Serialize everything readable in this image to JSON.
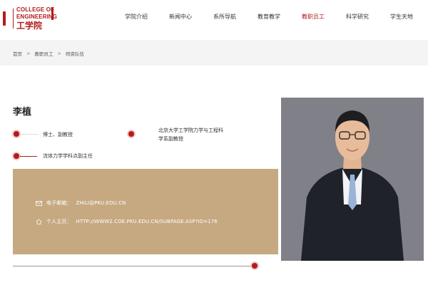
{
  "header": {
    "logo": {
      "en_line1": "COLLEGE OF",
      "en_line2": "ENGINEERING",
      "cn": "工学院"
    },
    "nav": [
      {
        "label": "学院介绍"
      },
      {
        "label": "新闻中心"
      },
      {
        "label": "系所导航"
      },
      {
        "label": "教育教学"
      },
      {
        "label": "教职员工",
        "active": true
      },
      {
        "label": "科学研究"
      },
      {
        "label": "学生天地"
      }
    ]
  },
  "breadcrumb": {
    "items": [
      "首页",
      "教职员工",
      "师资队伍"
    ],
    "separator": ">"
  },
  "profile": {
    "name": "李植",
    "title": "博士、副教授",
    "affiliation_line1": "北京大学工学院力学与工程科",
    "affiliation_line2": "学系副教授",
    "role": "流体力学学科点副主任",
    "email_label": "电子邮箱：",
    "email": "ZHILI@PKU.EDU.CN",
    "homepage_label": "个人主页：",
    "homepage": "HTTP://WWW2.COE.PKU.EDU.CN/SUBPAGE.ASP?ID=176"
  },
  "colors": {
    "accent": "#b31b1b",
    "panel": "#c6a981",
    "photo_bg": "#7e7e84"
  },
  "icons": {
    "email": "envelope-icon",
    "homepage": "home-icon"
  }
}
